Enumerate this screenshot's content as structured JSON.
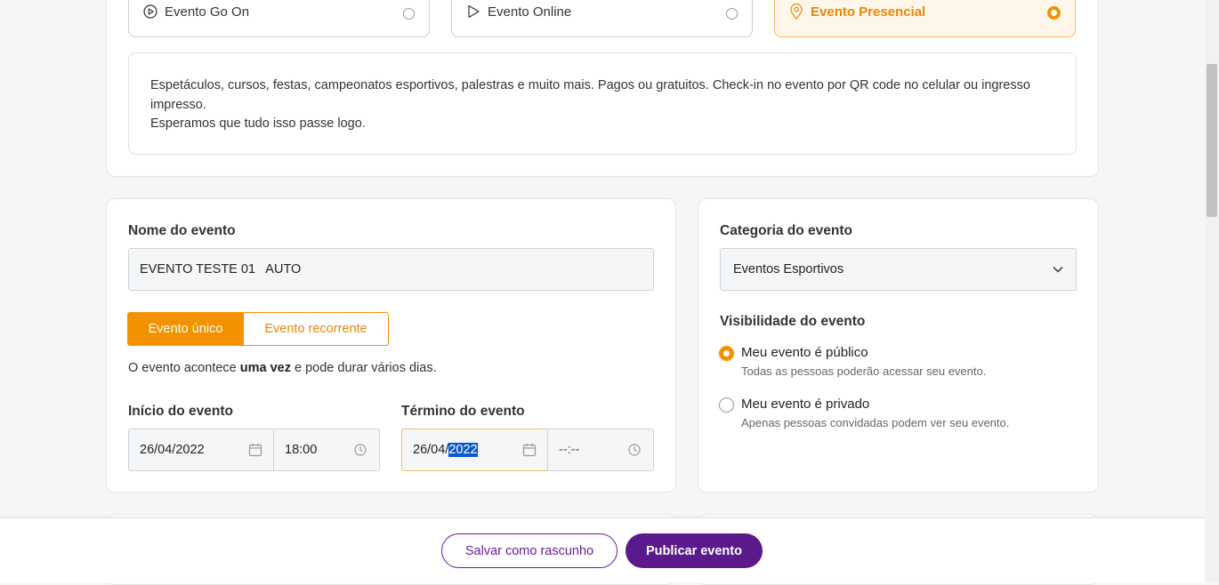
{
  "event_types": [
    {
      "label": "Evento Go On",
      "icon": "play-circle-icon",
      "selected": false
    },
    {
      "label": "Evento Online",
      "icon": "play-icon",
      "selected": false
    },
    {
      "label": "Evento Presencial",
      "icon": "map-pin-icon",
      "selected": true
    }
  ],
  "description": {
    "line1": "Espetáculos, cursos, festas, campeonatos esportivos, palestras e muito mais. Pagos ou gratuitos. Check-in no evento por QR code no celular ou ingresso impresso.",
    "line2": "Esperamos que tudo isso passe logo."
  },
  "event_name": {
    "label": "Nome do evento",
    "value": "EVENTO TESTE 01   AUTO"
  },
  "frequency": {
    "single_label": "Evento único",
    "recurring_label": "Evento recorrente",
    "selected": "single",
    "hint_prefix": "O evento acontece ",
    "hint_bold": "uma vez",
    "hint_suffix": " e pode durar vários dias."
  },
  "start": {
    "label": "Início do evento",
    "date": "26/04/2022",
    "time": "18:00"
  },
  "end": {
    "label": "Término do evento",
    "date_prefix": "26/04/",
    "date_selected": "2022",
    "time_placeholder": "--:--"
  },
  "category": {
    "label": "Categoria do evento",
    "value": "Eventos Esportivos"
  },
  "visibility": {
    "label": "Visibilidade do evento",
    "options": [
      {
        "title": "Meu evento é público",
        "subtitle": "Todas as pessoas poderão acessar seu evento.",
        "selected": true
      },
      {
        "title": "Meu evento é privado",
        "subtitle": "Apenas pessoas convidadas podem ver seu evento.",
        "selected": false
      }
    ]
  },
  "footer": {
    "draft_label": "Salvar como rascunho",
    "publish_label": "Publicar evento"
  },
  "colors": {
    "accent": "#f39200",
    "primary": "#5b1a8c"
  }
}
